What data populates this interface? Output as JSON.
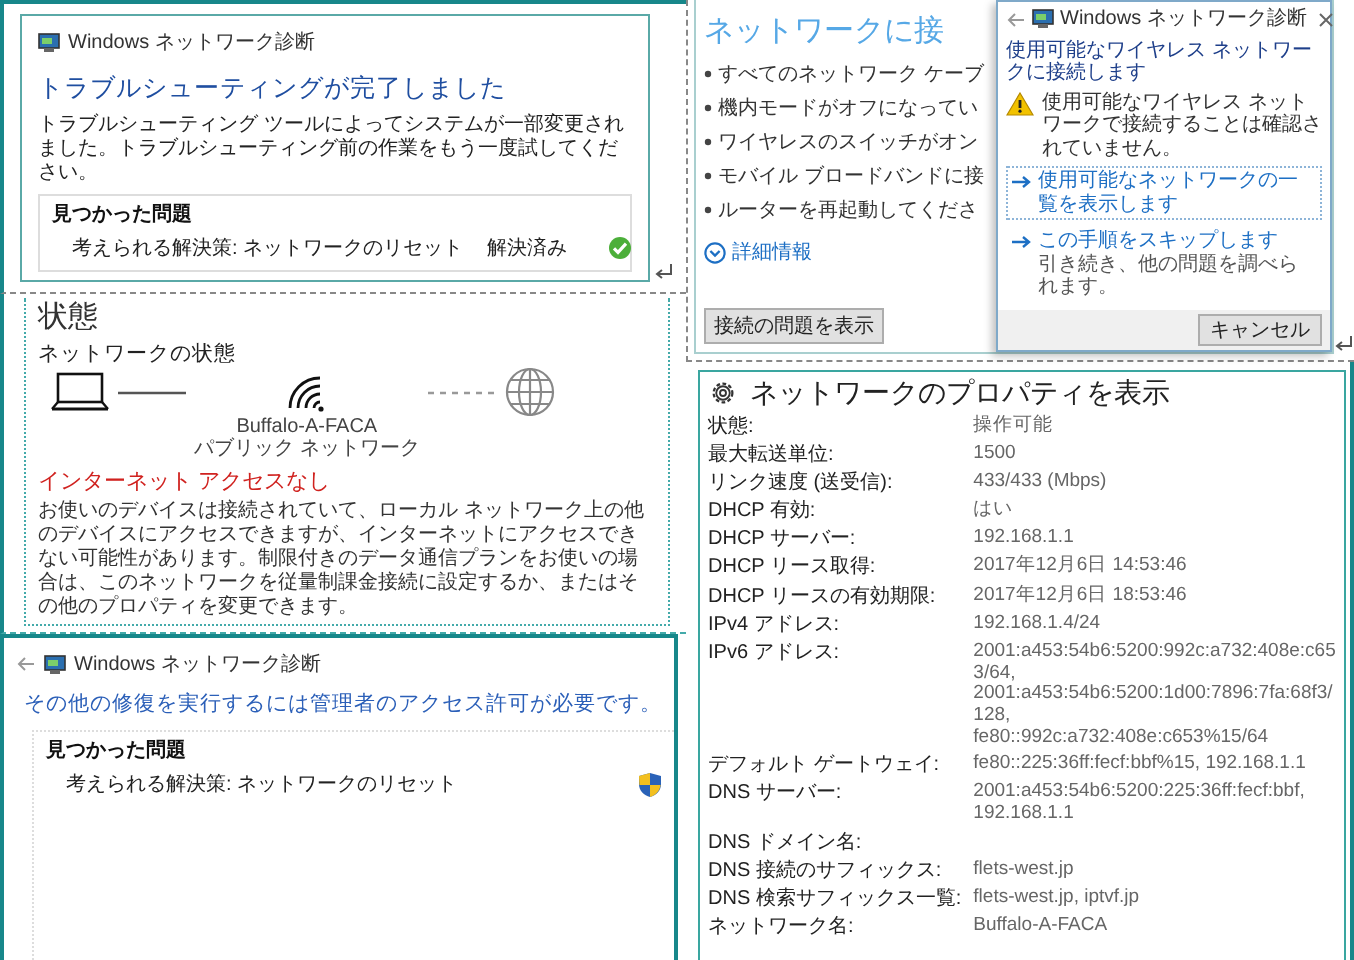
{
  "troubleshoot_complete": {
    "window_title": "Windows ネットワーク診断",
    "heading": "トラブルシューティングが完了しました",
    "message": "トラブルシューティング ツールによってシステムが一部変更されました。トラブルシューティング前の作業をもう一度試してください。",
    "problems": {
      "title": "見つかった問題",
      "items": [
        {
          "label": "考えられる解決策: ネットワークのリセット",
          "status": "解決済み",
          "kind": "resolved"
        }
      ]
    }
  },
  "connect_screen": {
    "heading": "ネットワークに接",
    "bullets": [
      "すべてのネットワーク ケーブ",
      "機内モードがオフになってい",
      "ワイヤレスのスイッチがオン",
      "モバイル ブロードバンドに接",
      "ルーターを再起動してくださ"
    ],
    "more_info": "詳細情報",
    "button": "接続の問題を表示",
    "dialog": {
      "title": "Windows ネットワーク診断",
      "heading": "使用可能なワイヤレス ネットワークに接続します",
      "warning": "使用可能なワイヤレス ネットワークで接続することは確認されていません。",
      "options": [
        {
          "label": "使用可能なネットワークの一覧を表示します",
          "selected": true
        },
        {
          "label": "この手順をスキップします",
          "note": "引き続き、他の問題を調べられます。",
          "selected": false
        }
      ],
      "cancel": "キャンセル"
    }
  },
  "status_page": {
    "title": "状態",
    "section": "ネットワークの状態",
    "network_name": "Buffalo-A-FACA",
    "network_type": "パブリック ネットワーク",
    "alert": "インターネット アクセスなし",
    "description": "お使いのデバイスは接続されていて、ローカル ネットワーク上の他のデバイスにアクセスできますが、インターネットにアクセスできない可能性があります。制限付きのデータ通信プランをお使いの場合は、このネットワークを従量制課金接続に設定するか、またはその他のプロパティを変更できます。"
  },
  "admin_screen": {
    "window_title": "Windows ネットワーク診断",
    "heading": "その他の修復を実行するには管理者のアクセス許可が必要です。",
    "problems": {
      "title": "見つかった問題",
      "items": [
        {
          "label": "考えられる解決策: ネットワークのリセット",
          "kind": "needs_admin"
        }
      ]
    }
  },
  "properties": {
    "title": "ネットワークのプロパティを表示",
    "rows": [
      {
        "label": "状態:",
        "values": [
          "操作可能"
        ]
      },
      {
        "label": "最大転送単位:",
        "values": [
          "1500"
        ]
      },
      {
        "label": "リンク速度 (送受信):",
        "values": [
          "433/433 (Mbps)"
        ]
      },
      {
        "label": "DHCP 有効:",
        "values": [
          "はい"
        ]
      },
      {
        "label": "DHCP サーバー:",
        "values": [
          "192.168.1.1"
        ]
      },
      {
        "label": "DHCP リース取得:",
        "values": [
          "2017年12月6日 14:53:46"
        ]
      },
      {
        "label": "DHCP リースの有効期限:",
        "values": [
          "2017年12月6日 18:53:46"
        ]
      },
      {
        "label": "IPv4 アドレス:",
        "values": [
          "192.168.1.4/24"
        ]
      },
      {
        "label": "IPv6 アドレス:",
        "values": [
          "2001:a453:54b6:5200:992c:a732:408e:c653/64,",
          "2001:a453:54b6:5200:1d00:7896:7fa:68f3/128,",
          "fe80::992c:a732:408e:c653%15/64"
        ]
      },
      {
        "label": "デフォルト ゲートウェイ:",
        "values": [
          "fe80::225:36ff:fecf:bbf%15, 192.168.1.1"
        ]
      },
      {
        "label": "DNS サーバー:",
        "values": [
          "2001:a453:54b6:5200:225:36ff:fecf:bbf,",
          "192.168.1.1"
        ]
      },
      {
        "label": "DNS ドメイン名:",
        "values": []
      },
      {
        "label": "DNS 接続のサフィックス:",
        "values": [
          "flets-west.jp"
        ]
      },
      {
        "label": "DNS 検索サフィックス一覧:",
        "values": [
          "flets-west.jp, iptvf.jp"
        ]
      },
      {
        "label": "ネットワーク名:",
        "values": [
          "Buffalo-A-FACA"
        ]
      }
    ]
  }
}
